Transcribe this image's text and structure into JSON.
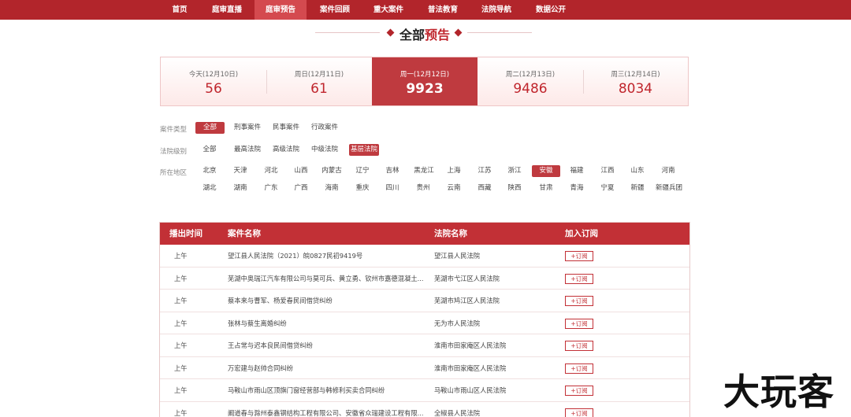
{
  "nav": {
    "items": [
      {
        "label": "首页"
      },
      {
        "label": "庭审直播"
      },
      {
        "label": "庭审预告"
      },
      {
        "label": "案件回顾"
      },
      {
        "label": "重大案件"
      },
      {
        "label": "普法教育"
      },
      {
        "label": "法院导航"
      },
      {
        "label": "数据公开"
      }
    ],
    "active": "庭审预告",
    "accent": "#b2252b"
  },
  "section_title": {
    "part1": "全部",
    "part2": "预告"
  },
  "date_tabs": [
    {
      "label": "今天(12月10日)",
      "count": "56",
      "active": false
    },
    {
      "label": "周日(12月11日)",
      "count": "61",
      "active": false
    },
    {
      "label": "周一(12月12日)",
      "count": "9923",
      "active": true
    },
    {
      "label": "周二(12月13日)",
      "count": "9486",
      "active": false
    },
    {
      "label": "周三(12月14日)",
      "count": "8034",
      "active": false
    }
  ],
  "filters": {
    "case_type": {
      "label": "案件类型",
      "options": [
        "全部",
        "刑事案件",
        "民事案件",
        "行政案件"
      ],
      "selected": "全部"
    },
    "court_level": {
      "label": "法院级别",
      "options": [
        "全部",
        "最高法院",
        "高级法院",
        "中级法院",
        "基层法院"
      ],
      "selected": "基层法院"
    },
    "region": {
      "label": "所在地区",
      "row1": [
        "北京",
        "天津",
        "河北",
        "山西",
        "内蒙古",
        "辽宁",
        "吉林",
        "黑龙江",
        "上海",
        "江苏",
        "浙江",
        "安徽",
        "福建",
        "江西",
        "山东",
        "河南"
      ],
      "row2": [
        "湖北",
        "湖南",
        "广东",
        "广西",
        "海南",
        "重庆",
        "四川",
        "贵州",
        "云南",
        "西藏",
        "陕西",
        "甘肃",
        "青海",
        "宁夏",
        "新疆",
        "新疆兵团"
      ],
      "selected": "安徽"
    }
  },
  "table": {
    "headers": [
      "播出时间",
      "案件名称",
      "法院名称",
      "加入订阅"
    ],
    "subscribe_label": "+订阅",
    "rows": [
      {
        "time": "上午",
        "case": "望江县人民法院（2021）皖0827民初9419号",
        "court": "望江县人民法院"
      },
      {
        "time": "上午",
        "case": "芜湖中奥瑞江汽车有限公司与莫可兵、黄立勇、钦州市嘉德混凝土...",
        "court": "芜湖市弋江区人民法院"
      },
      {
        "time": "上午",
        "case": "蔡本来与曹军、杨爱春民间借贷纠纷",
        "court": "芜湖市鸠江区人民法院"
      },
      {
        "time": "上午",
        "case": "张林与蔡生离婚纠纷",
        "court": "无为市人民法院"
      },
      {
        "time": "上午",
        "case": "王占常与迟本良民间借贷纠纷",
        "court": "淮南市田家庵区人民法院"
      },
      {
        "time": "上午",
        "case": "万宏建与赵帅合同纠纷",
        "court": "淮南市田家庵区人民法院"
      },
      {
        "time": "上午",
        "case": "马鞍山市雨山区顶旗门窗经营部与韩修利买卖合同纠纷",
        "court": "马鞍山市雨山区人民法院"
      },
      {
        "time": "上午",
        "case": "阚道春与滁州泰鑫钢结构工程有限公司、安徽省众瑞建设工程有限...",
        "court": "全椒县人民法院"
      }
    ]
  },
  "watermark": {
    "text": "大玩客"
  }
}
